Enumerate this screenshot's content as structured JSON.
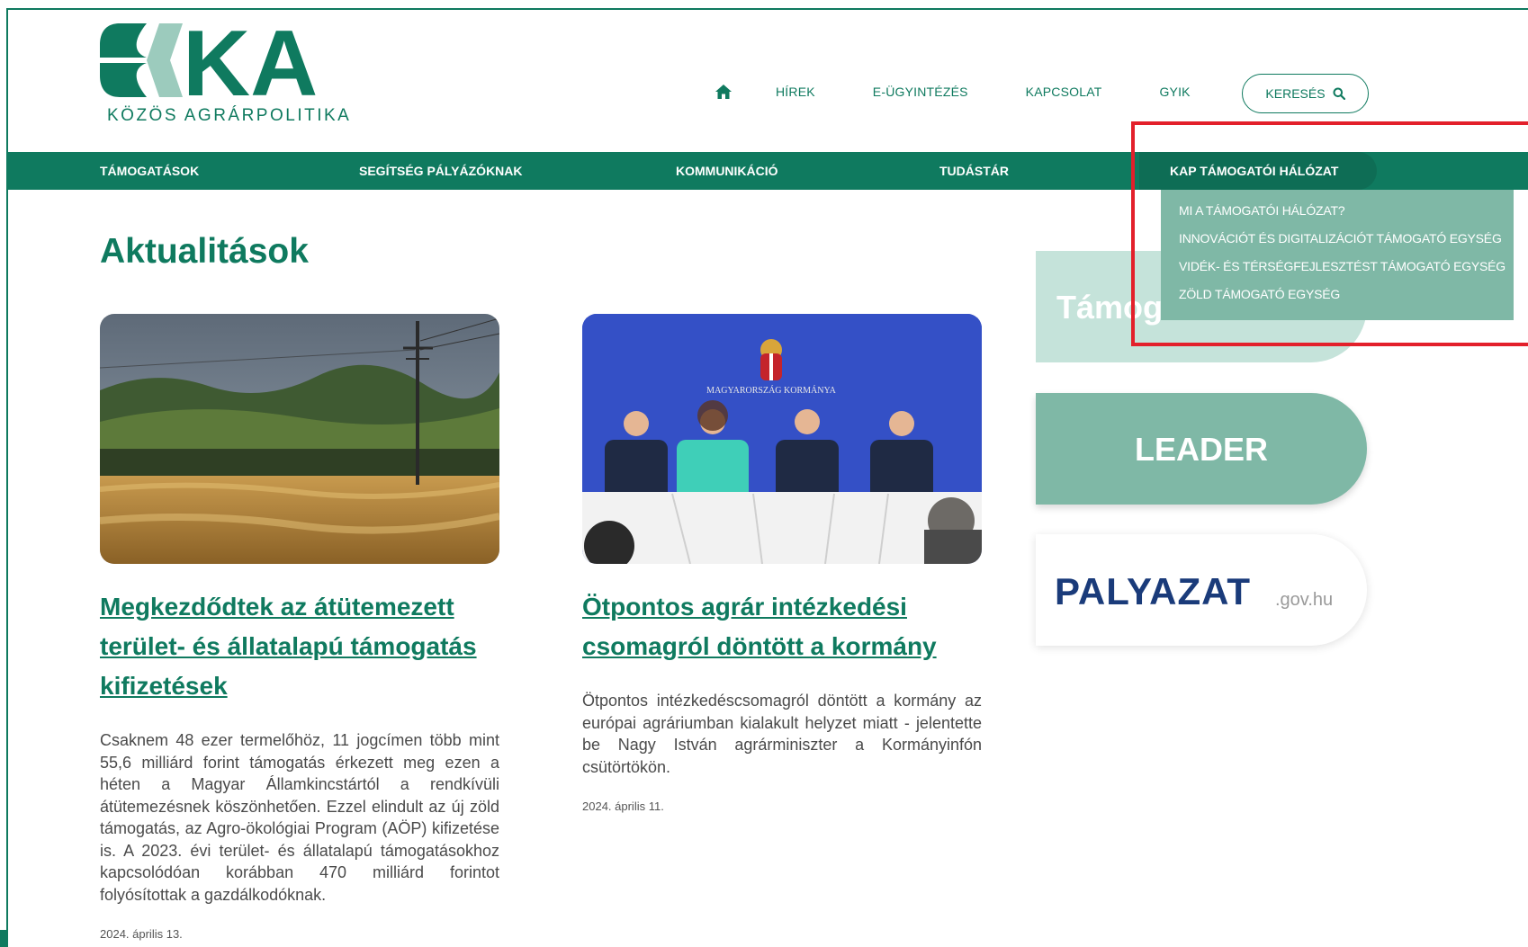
{
  "logo": {
    "brand": "KAP",
    "subtitle": "KÖZÖS AGRÁRPOLITIKA"
  },
  "topnav": {
    "home_icon": "home-icon",
    "links": [
      "HÍREK",
      "E-ÜGYINTÉZÉS",
      "KAPCSOLAT",
      "GYIK"
    ],
    "search_label": "KERESÉS",
    "search_icon": "search-icon"
  },
  "mainnav": {
    "items": [
      "TÁMOGATÁSOK",
      "SEGÍTSÉG PÁLYÁZÓKNAK",
      "KOMMUNIKÁCIÓ",
      "TUDÁSTÁR",
      "KAP TÁMOGATÓI HÁLÓZAT"
    ]
  },
  "dropdown": {
    "items": [
      "MI A TÁMOGATÓI HÁLÓZAT?",
      "INNOVÁCIÓT ÉS DIGITALIZÁCIÓT TÁMOGATÓ EGYSÉG",
      "VIDÉK- ÉS TÉRSÉGFEJLESZTÉST TÁMOGATÓ EGYSÉG",
      "ZÖLD TÁMOGATÓ EGYSÉG"
    ]
  },
  "page": {
    "title": "Aktualitások"
  },
  "articles": [
    {
      "title": "Megkezdődtek az átütemezett terület- és állatalapú támogatás kifizetések",
      "body": "Csaknem 48 ezer termelőhöz, 11 jogcímen több mint 55,6 milliárd forint támogatás érkezett meg ezen a héten a Magyar Államkincstártól a rendkívüli átütemezésnek köszönhetően. Ezzel elindult az új zöld támogatás, az Agro-ökológiai Program (AÖP) kifizetése is. A 2023. évi terület- és állatalapú támogatásokhoz kapcsolódóan korábban 470 milliárd forintot folyósítottak a gazdálkodóknak.",
      "date": "2024. április 13."
    },
    {
      "title": "Ötpontos agrár intézkedési csomagról döntött a kormány",
      "body": "Ötpontos intézkedéscsomagról döntött a kormány az európai agráriumban kialakult helyzet miatt - jelentette be Nagy István agrárminiszter a Kormányinfón csütörtökön.",
      "date": "2024. április 11.",
      "image_caption": "MAGYARORSZÁG KORMÁNYA"
    }
  ],
  "banners": {
    "tamogatasok": "Támog",
    "leader": "LEADER",
    "palyazat": "PALYAZAT",
    "palyazat_suffix": ".gov.hu"
  },
  "colors": {
    "brand_green": "#0f7a5f",
    "light_green": "#7fb8a6",
    "pale_green": "#c5e3da",
    "highlight_red": "#e3202b",
    "palyazat_blue": "#1a3b7a"
  }
}
